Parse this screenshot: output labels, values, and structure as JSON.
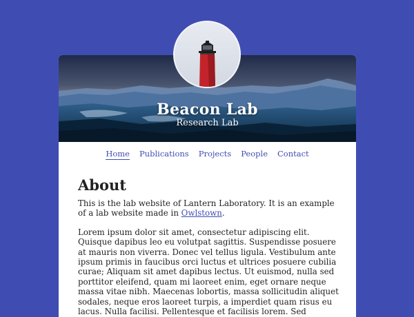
{
  "site": {
    "title": "Beacon Lab",
    "subtitle": "Research Lab",
    "logo_icon": "lighthouse-icon",
    "banner_image": "mountain-landscape"
  },
  "nav": {
    "items": [
      {
        "label": "Home",
        "active": true
      },
      {
        "label": "Publications",
        "active": false
      },
      {
        "label": "Projects",
        "active": false
      },
      {
        "label": "People",
        "active": false
      },
      {
        "label": "Contact",
        "active": false
      }
    ]
  },
  "main": {
    "heading": "About",
    "intro_before_link": "This is the lab website of Lantern Laboratory. It is an example of a lab website made in ",
    "intro_link": "Owlstown",
    "intro_after_link": ".",
    "lorem": "Lorem ipsum dolor sit amet, consectetur adipiscing elit. Quisque dapibus leo eu volutpat sagittis. Suspendisse posuere at mauris non viverra. Donec vel tellus ligula. Vestibulum ante ipsum primis in faucibus orci luctus et ultrices posuere cubilia curae; Aliquam sit amet dapibus lectus. Ut euismod, nulla sed porttitor eleifend, quam mi laoreet enim, eget ornare neque massa vitae nibh. Maecenas lobortis, massa sollicitudin aliquet sodales, neque eros laoreet turpis, a imperdiet quam risus eu lacus. Nulla facilisi. Pellentesque et facilisis lorem. Sed"
  },
  "colors": {
    "background": "#3f4db3",
    "link": "#3f4db3",
    "text": "#222222",
    "card": "#ffffff",
    "lighthouse": "#c3242b"
  }
}
